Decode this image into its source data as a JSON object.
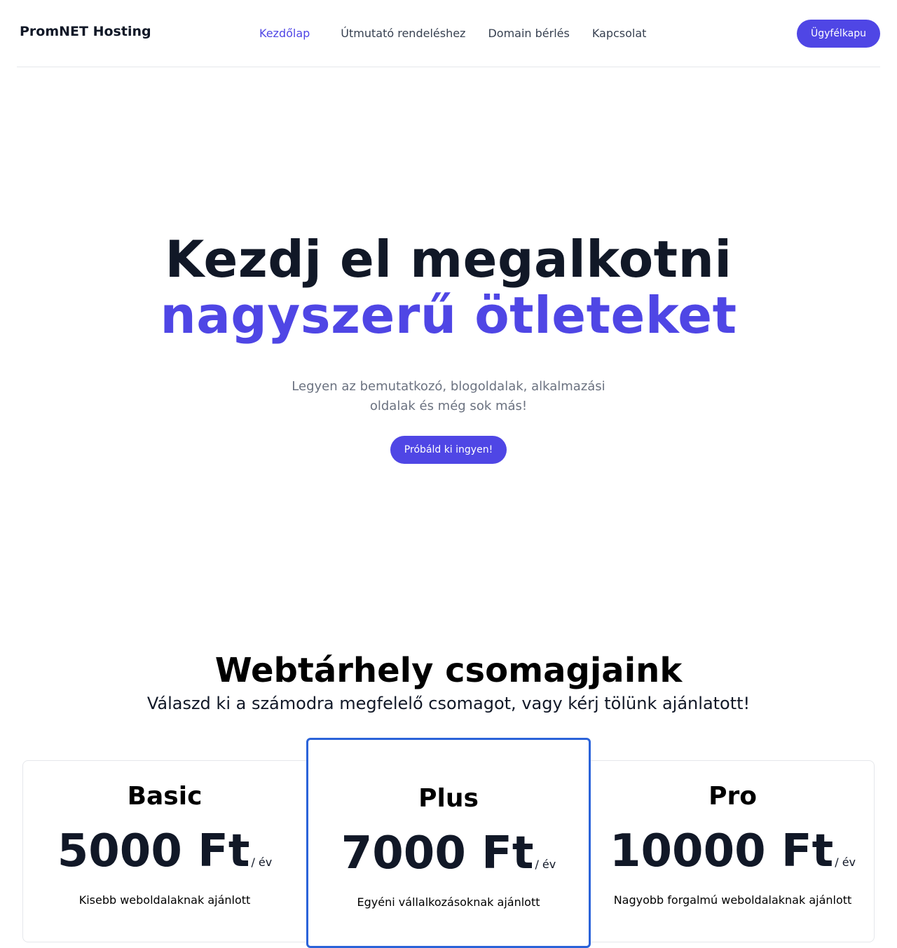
{
  "header": {
    "brand": "PromNET Hosting",
    "nav": [
      {
        "label": "Kezdőlap",
        "active": true
      },
      {
        "label": "Útmutató rendeléshez",
        "active": false
      },
      {
        "label": "Domain bérlés",
        "active": false
      },
      {
        "label": "Kapcsolat",
        "active": false
      }
    ],
    "portal_button": "Ügyfélkapu"
  },
  "hero": {
    "title_line1": "Kezdj el megalkotni",
    "title_line2": "nagyszerű ötleteket",
    "description": "Legyen az bemutatkozó, blogoldalak, alkalmazási oldalak és még sok más!",
    "cta": "Próbáld ki ingyen!"
  },
  "pricing": {
    "title": "Webtárhely csomagjaink",
    "subtitle": "Válaszd ki a számodra megfelelő csomagot, vagy kérj tölünk ajánlatott!",
    "plans": [
      {
        "name": "Basic",
        "price": "5000 Ft",
        "period": "/ év",
        "description": "Kisebb weboldalaknak ajánlott",
        "highlighted": false
      },
      {
        "name": "Plus",
        "price": "7000 Ft",
        "period": "/ év",
        "description": "Egyéni vállalkozásoknak ajánlott",
        "highlighted": true
      },
      {
        "name": "Pro",
        "price": "10000 Ft",
        "period": "/ év",
        "description": "Nagyobb forgalmú weboldalaknak ajánlott",
        "highlighted": false
      }
    ]
  },
  "colors": {
    "accent": "#4f46e5",
    "highlight_border": "#2b63d9",
    "text_dark": "#111827",
    "text_muted": "#6b7280"
  }
}
